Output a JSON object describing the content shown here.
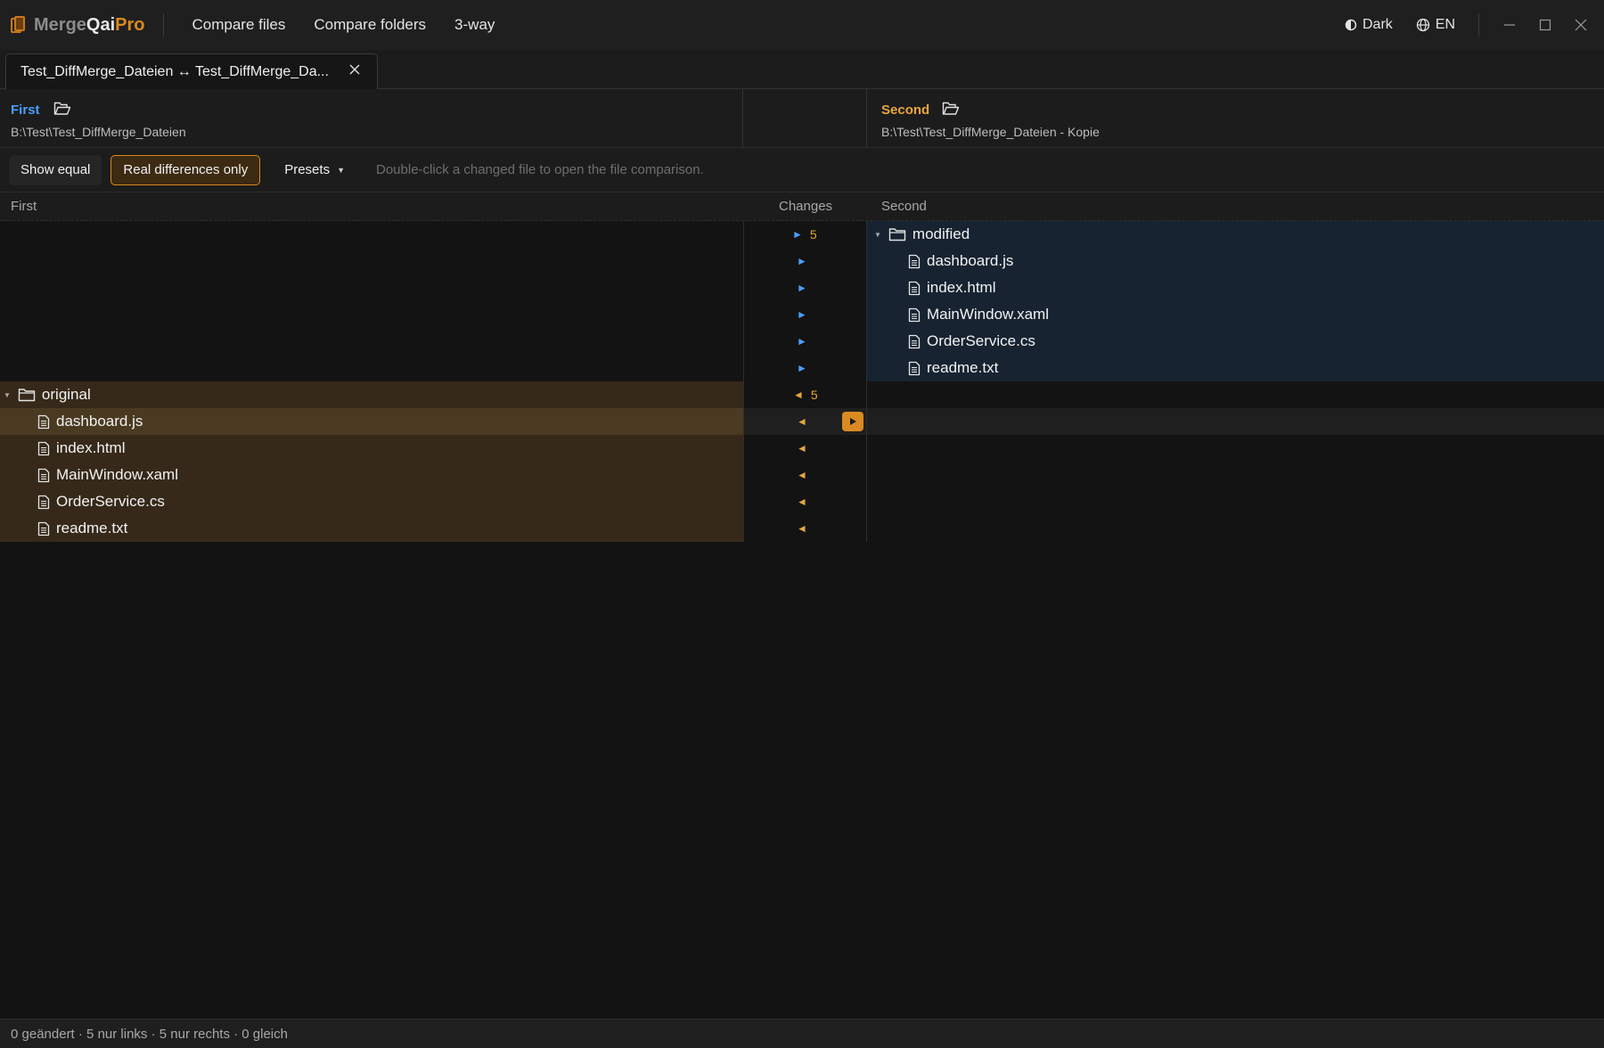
{
  "app": {
    "logo_merge": "Merge",
    "logo_qai": "Qai",
    "logo_pro": "Pro",
    "menu": [
      "Compare files",
      "Compare folders",
      "3-way"
    ],
    "theme_label": "Dark",
    "language_label": "EN"
  },
  "tab": {
    "title": "Test_DiffMerge_Dateien ↔ Test_DiffMerge_Da..."
  },
  "paths": {
    "first_label": "First",
    "first_path": "B:\\Test\\Test_DiffMerge_Dateien",
    "second_label": "Second",
    "second_path": "B:\\Test\\Test_DiffMerge_Dateien - Kopie"
  },
  "toolbar": {
    "show_equal": "Show equal",
    "real_differences": "Real differences only",
    "presets": "Presets",
    "hint": "Double-click a changed file to open the file comparison."
  },
  "columns": {
    "first": "First",
    "changes": "Changes",
    "second": "Second"
  },
  "right_tree": {
    "folder": "modified",
    "folder_count": "5",
    "files": [
      "dashboard.js",
      "index.html",
      "MainWindow.xaml",
      "OrderService.cs",
      "readme.txt"
    ]
  },
  "left_tree": {
    "folder": "original",
    "folder_count": "5",
    "files": [
      "dashboard.js",
      "index.html",
      "MainWindow.xaml",
      "OrderService.cs",
      "readme.txt"
    ]
  },
  "glyphs": {
    "right_arrow": "►",
    "left_arrow": "◄",
    "twisty": "▼",
    "caret": "▼"
  },
  "colors": {
    "accent": "#d98a22",
    "first_label": "#4a9eff",
    "second_label": "#e8a540",
    "right_only_bg": "#172331",
    "left_only_bg": "#362919",
    "right_arrow": "#4a9eff",
    "left_arrow": "#e8a540"
  },
  "status": {
    "text": "0 geändert · 5 nur links · 5 nur rechts · 0 gleich"
  }
}
